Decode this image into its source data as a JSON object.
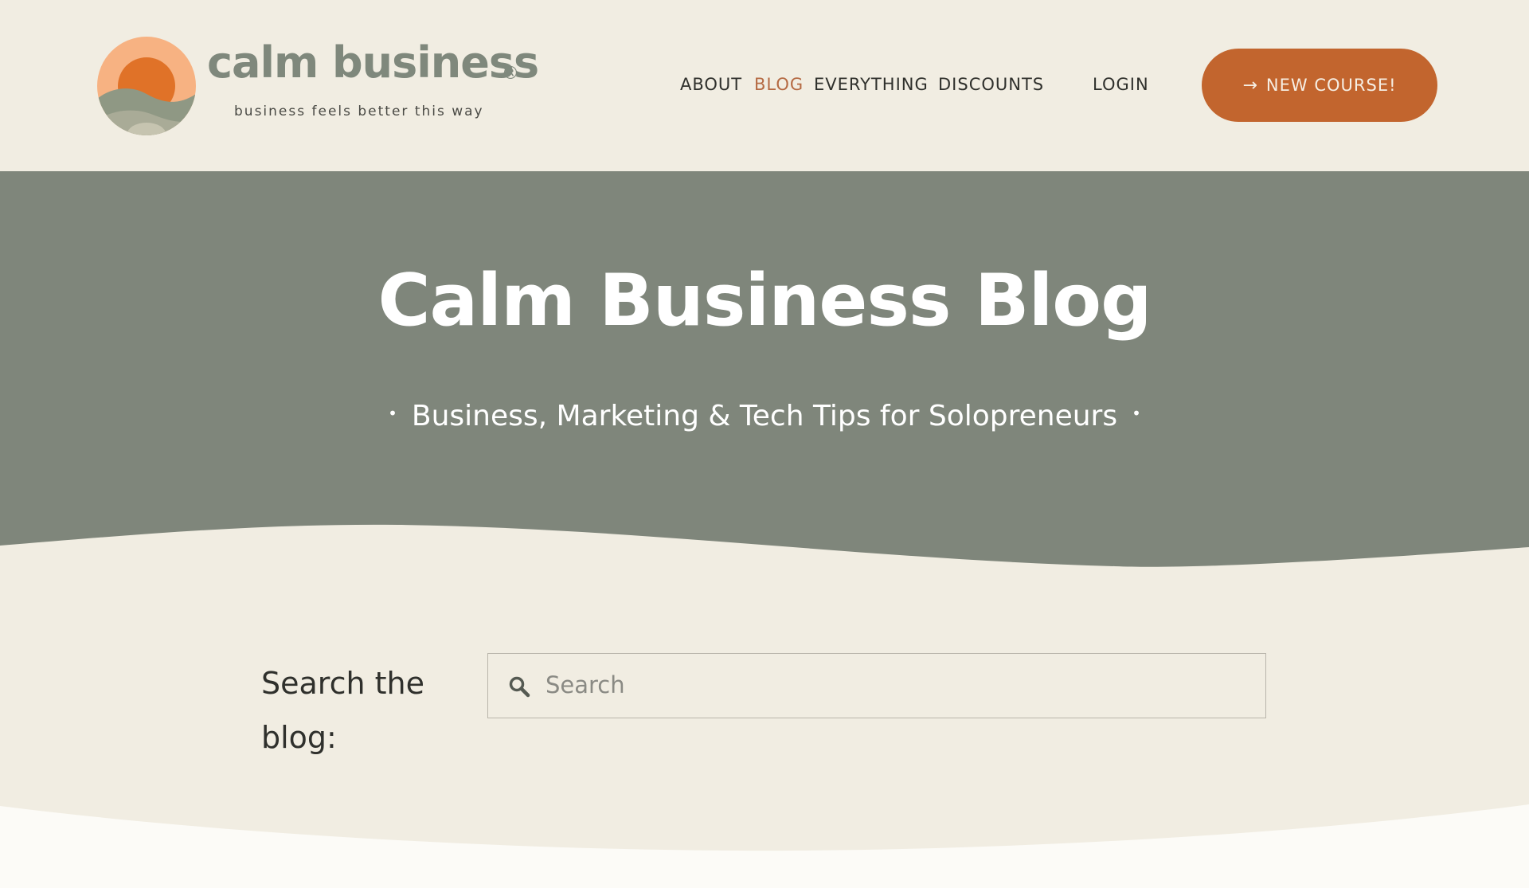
{
  "brand": {
    "name": "calm business",
    "registered": "®",
    "tagline": "business feels better this way",
    "colors": {
      "sun_outer": "#f7b282",
      "sun_inner": "#e07228",
      "hill_dark": "#8f9884",
      "hill_light": "#b7b6a1"
    }
  },
  "nav": {
    "items": [
      {
        "label": "ABOUT",
        "active": false
      },
      {
        "label": "BLOG",
        "active": true
      },
      {
        "label": "EVERYTHING",
        "active": false
      },
      {
        "label": "DISCOUNTS",
        "active": false
      },
      {
        "label": "LOGIN",
        "active": false
      }
    ],
    "cta": {
      "icon": "arrow-right-icon",
      "arrow": "→",
      "label": "NEW COURSE!"
    }
  },
  "hero": {
    "title": "Calm Business Blog",
    "subtitle": "Business, Marketing & Tech Tips for Solopreneurs",
    "bullet": "•"
  },
  "search": {
    "label": "Search the blog:",
    "placeholder": "Search",
    "value": "",
    "icon": "search-icon"
  },
  "colors": {
    "page_bg": "#f1ede2",
    "hero_bg": "#7f867b",
    "accent": "#c2652e",
    "nav_active": "#b56a43",
    "bottom_bg": "#fcfbf7"
  }
}
